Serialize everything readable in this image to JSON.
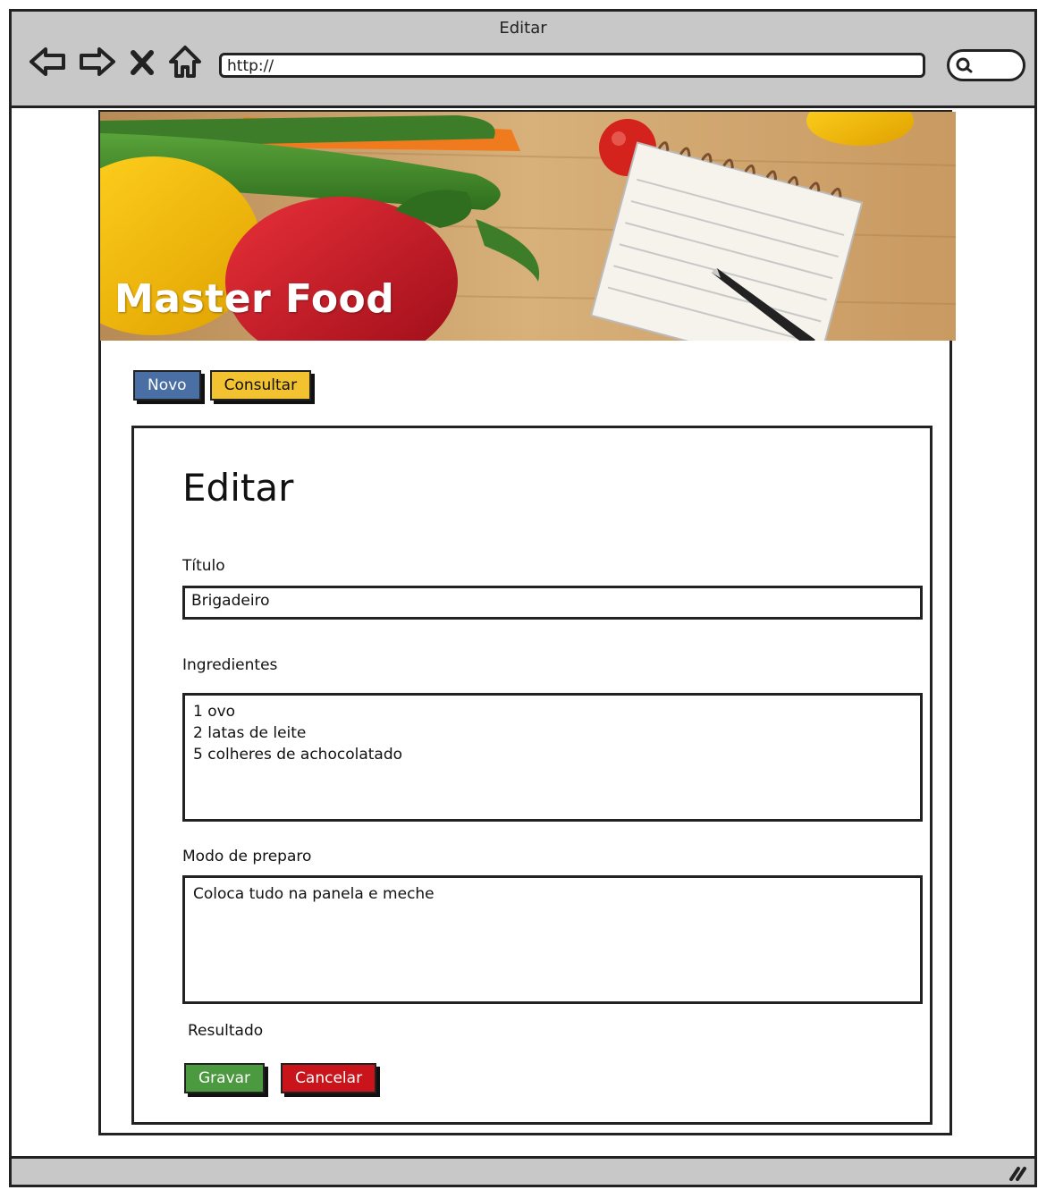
{
  "window": {
    "title": "Editar",
    "url": "http://"
  },
  "hero": {
    "title": "Master Food"
  },
  "nav": {
    "novo_label": "Novo",
    "consultar_label": "Consultar",
    "novo_color": "#4a6fa5",
    "consultar_color": "#f2c230"
  },
  "form": {
    "heading": "Editar",
    "titulo_label": "Título",
    "titulo_value": "Brigadeiro",
    "ingredientes_label": "Ingredientes",
    "ingredientes_value": "1 ovo\n2 latas de leite\n5 colheres de achocolatado",
    "modo_label": "Modo de preparo",
    "modo_value": "Coloca tudo na panela e meche",
    "resultado_label": "Resultado",
    "gravar_label": "Gravar",
    "cancelar_label": "Cancelar",
    "gravar_color": "#4c9a3f",
    "cancelar_color": "#c8141a"
  },
  "icons": {
    "back": "back-arrow-icon",
    "forward": "forward-arrow-icon",
    "stop": "close-icon",
    "home": "home-icon",
    "search": "search-icon",
    "resize": "resize-grip-icon"
  }
}
